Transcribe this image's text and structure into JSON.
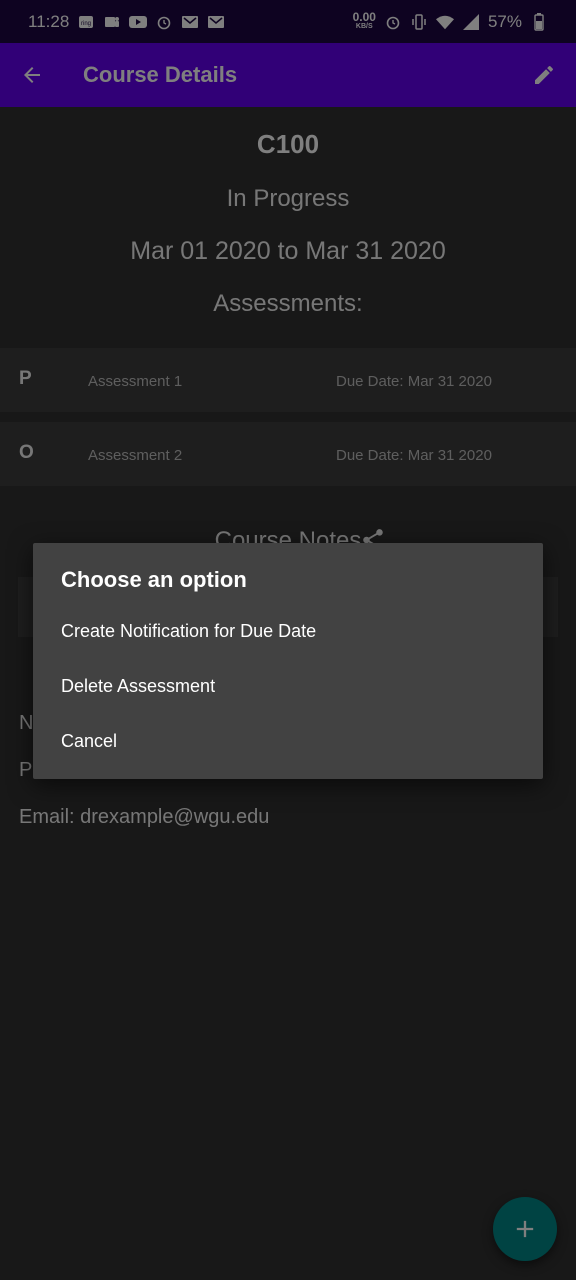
{
  "status_bar": {
    "time": "11:28",
    "net_speed_value": "0.00",
    "net_speed_unit": "KB/S",
    "battery": "57%",
    "icons": [
      "ring-icon",
      "teams-icon",
      "youtube-icon",
      "alarm-icon",
      "gmail-icon",
      "gmail-icon",
      "alarm-icon",
      "vibrate-icon",
      "wifi-icon",
      "signal-icon",
      "battery-icon"
    ]
  },
  "app_bar": {
    "title": "Course Details"
  },
  "course": {
    "code": "C100",
    "status": "In Progress",
    "dates": "Mar 01 2020 to Mar 31 2020",
    "assessments_heading": "Assessments:"
  },
  "assessments": [
    {
      "type": "P",
      "name": "Assessment 1",
      "due": "Due Date: Mar 31 2020"
    },
    {
      "type": "O",
      "name": "Assessment 2",
      "due": "Due Date: Mar 31 2020"
    }
  ],
  "notes": {
    "heading": "Course Notes"
  },
  "mentor": {
    "name_line": "N",
    "phone_line": "P",
    "email_line": "Email: drexample@wgu.edu"
  },
  "dialog": {
    "title": "Choose an option",
    "options": [
      "Create Notification for Due Date",
      "Delete Assessment",
      "Cancel"
    ]
  },
  "colors": {
    "app_bar": "#6200ee",
    "status_bar": "#1c0742",
    "fab": "#018786",
    "dialog": "#424242"
  }
}
